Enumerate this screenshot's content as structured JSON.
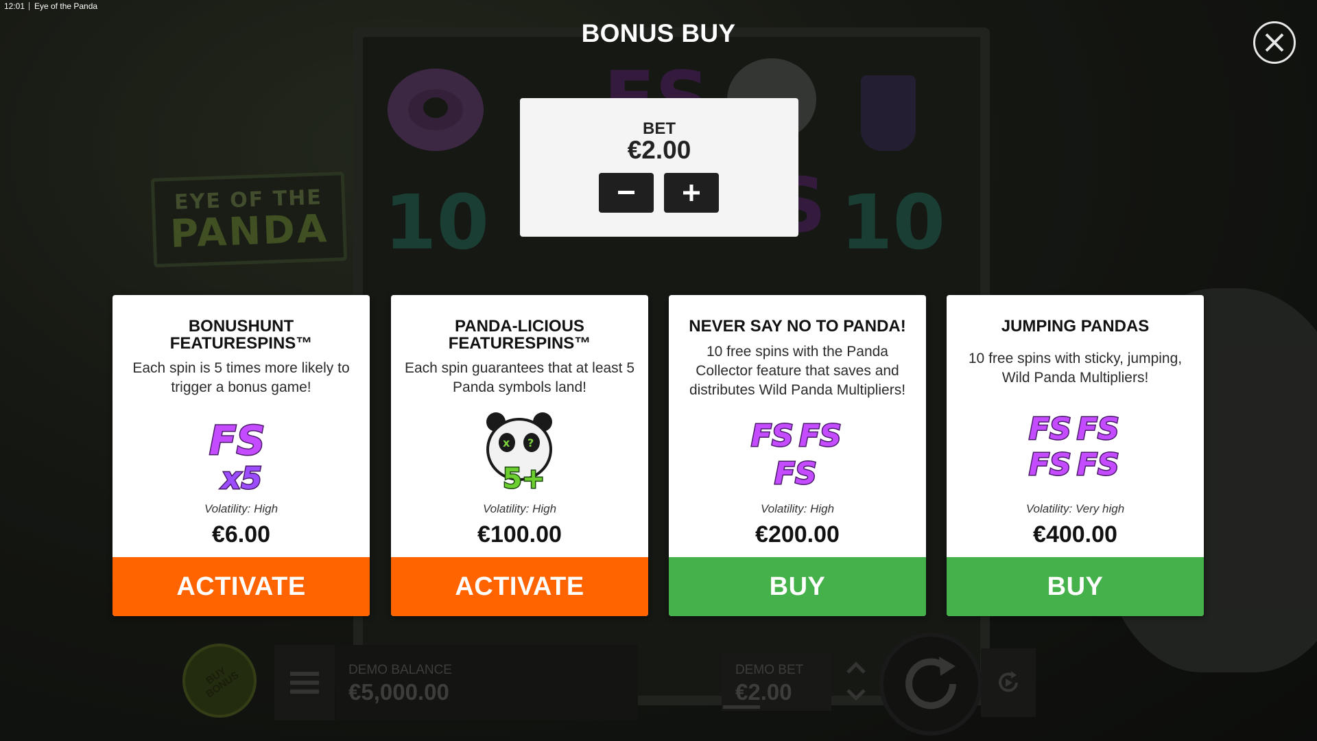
{
  "status_bar": {
    "time": "12:01",
    "app_title": "Eye of the Panda"
  },
  "background": {
    "logo_line1": "EYE OF THE",
    "logo_line2": "PANDA",
    "reel_symbols": [
      "10",
      "10",
      "FS",
      "FS"
    ]
  },
  "overlay": {
    "title": "BONUS BUY",
    "close_icon": "close-icon"
  },
  "bet": {
    "label": "BET",
    "value": "€2.00",
    "minus_icon": "minus-icon",
    "plus_icon": "plus-icon"
  },
  "cards": [
    {
      "title": "BONUSHUNT FEATURESPINS™",
      "description": "Each spin is 5 times more likely to trigger a bonus game!",
      "icon": "fs-x5-icon",
      "volatility": "Volatility: High",
      "price": "€6.00",
      "action": "ACTIVATE",
      "action_color": "#ff6400"
    },
    {
      "title": "PANDA-LICIOUS FEATURESPINS™",
      "description": "Each spin guarantees that at least 5 Panda symbols land!",
      "icon": "panda-5plus-icon",
      "volatility": "Volatility: High",
      "price": "€100.00",
      "action": "ACTIVATE",
      "action_color": "#ff6400"
    },
    {
      "title": "NEVER SAY NO TO PANDA!",
      "description": "10 free spins with the Panda Collector feature that saves and distributes Wild Panda Multipliers!",
      "icon": "fs-three-icon",
      "volatility": "Volatility: High",
      "price": "€200.00",
      "action": "BUY",
      "action_color": "#45b14b"
    },
    {
      "title": "JUMPING PANDAS",
      "description": "10 free spins with sticky, jumping, Wild Panda Multipliers!",
      "icon": "fs-four-icon",
      "volatility": "Volatility: Very high",
      "price": "€400.00",
      "action": "BUY",
      "action_color": "#45b14b"
    }
  ],
  "hud": {
    "buy_bonus_label": "BUY BONUS",
    "menu_icon": "menu-icon",
    "balance_label": "DEMO BALANCE",
    "balance_value": "€5,000.00",
    "bet_label": "DEMO BET",
    "bet_value": "€2.00",
    "bet_arrows_icon": "bet-up-down-icon",
    "spin_icon": "spin-icon",
    "autoplay_icon": "autoplay-icon"
  },
  "colors": {
    "activate": "#ff6400",
    "buy": "#45b14b",
    "card_bg": "#ffffff",
    "bet_panel_bg": "#f4f4f4"
  }
}
